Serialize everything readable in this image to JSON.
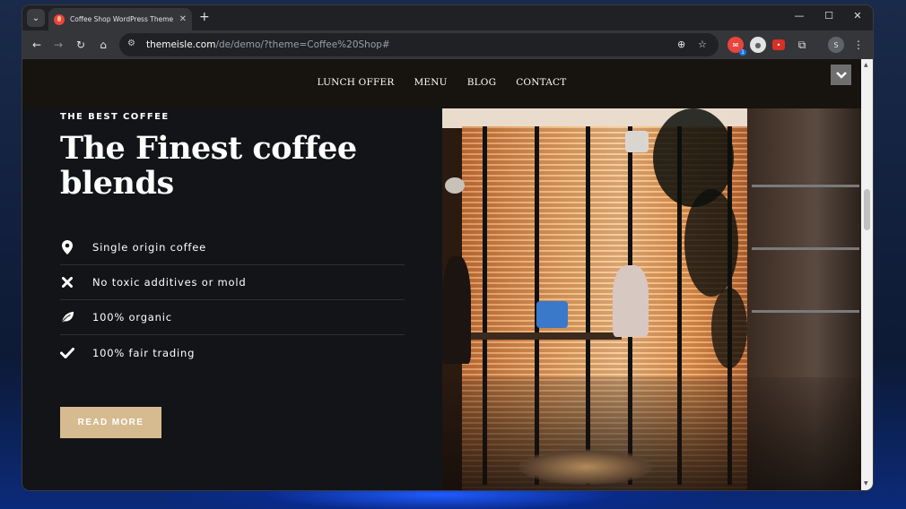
{
  "browser": {
    "tab_title": "Coffee Shop WordPress Theme Demo",
    "url_host": "themeisle.com",
    "url_path": "/de/demo/?theme=Coffee%20Shop#",
    "profile_initial": "S",
    "extension_badge": "1"
  },
  "site": {
    "nav": [
      {
        "label": "LUNCH OFFER"
      },
      {
        "label": "MENU"
      },
      {
        "label": "BLOG"
      },
      {
        "label": "CONTACT"
      }
    ],
    "eyebrow": "THE BEST COFFEE",
    "title": "The Finest coffee blends",
    "features": [
      {
        "label": "Single origin coffee",
        "icon": "map-pin-icon"
      },
      {
        "label": "No toxic additives or mold",
        "icon": "x-icon"
      },
      {
        "label": "100% organic",
        "icon": "leaf-icon"
      },
      {
        "label": "100% fair trading",
        "icon": "check-icon"
      }
    ],
    "cta_label": "READ MORE"
  },
  "colors": {
    "page_bg": "#121417",
    "header_bg": "#17130f",
    "accent": "#d6bb90",
    "text": "#ffffff"
  }
}
